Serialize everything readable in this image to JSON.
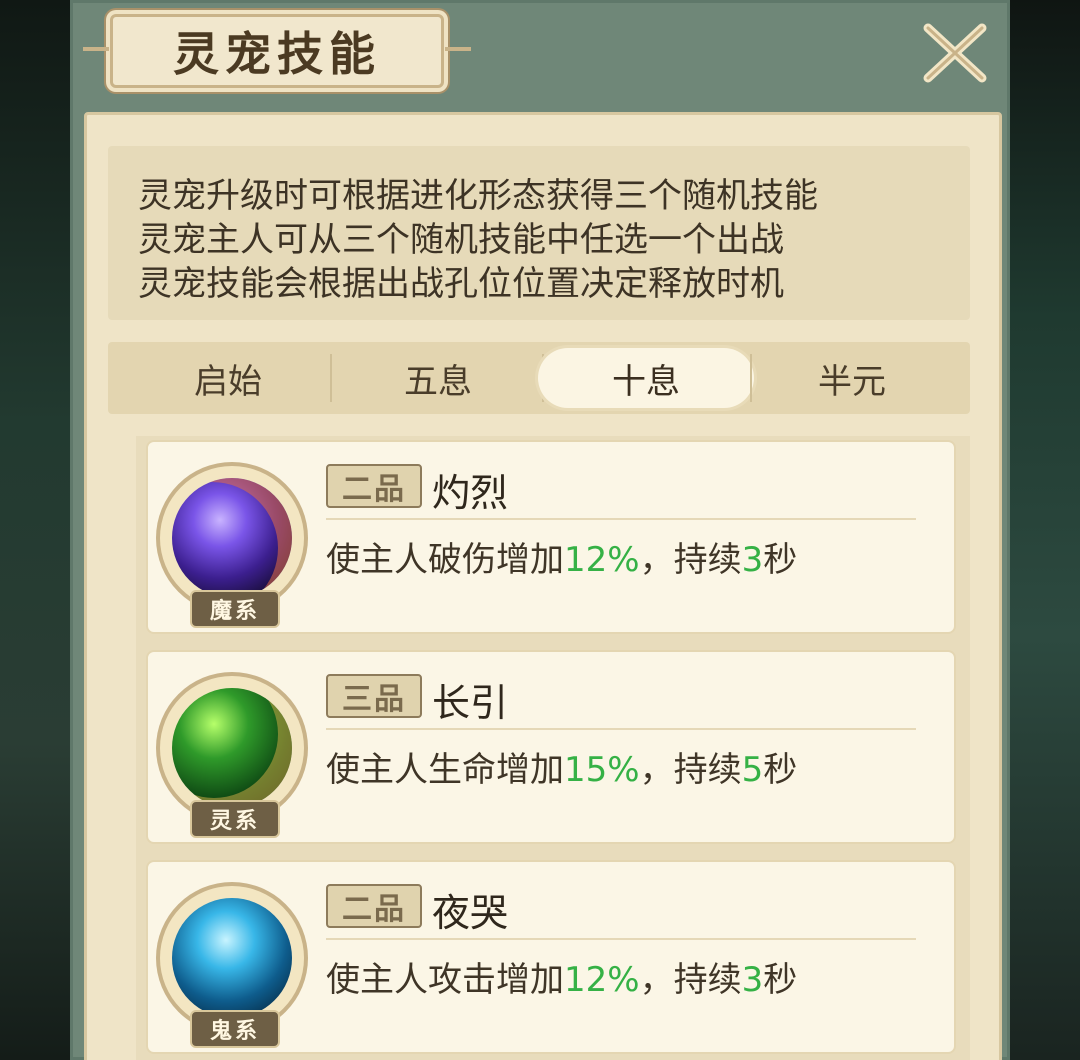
{
  "window": {
    "title": "灵宠技能",
    "close_icon": "close-icon"
  },
  "description": [
    "灵宠升级时可根据进化形态获得三个随机技能",
    "灵宠主人可从三个随机技能中任选一个出战",
    "灵宠技能会根据出战孔位位置决定释放时机"
  ],
  "tabs": [
    {
      "label": "启始",
      "active": false
    },
    {
      "label": "五息",
      "active": false
    },
    {
      "label": "十息",
      "active": true
    },
    {
      "label": "半元",
      "active": false
    }
  ],
  "skills": [
    {
      "grade": "二品",
      "name": "灼烈",
      "school": "魔系",
      "effect_prefix": "使主人破伤增加",
      "effect_value": "12%",
      "effect_mid": "，持续",
      "effect_duration": "3",
      "effect_unit": "秒",
      "icon": "purple-flame-skill-icon"
    },
    {
      "grade": "三品",
      "name": "长引",
      "school": "灵系",
      "effect_prefix": "使主人生命增加",
      "effect_value": "15%",
      "effect_mid": "，持续",
      "effect_duration": "5",
      "effect_unit": "秒",
      "icon": "green-blade-skill-icon"
    },
    {
      "grade": "二品",
      "name": "夜哭",
      "school": "鬼系",
      "effect_prefix": "使主人攻击增加",
      "effect_value": "12%",
      "effect_mid": "，持续",
      "effect_duration": "3",
      "effect_unit": "秒",
      "icon": "blue-spirit-skill-icon"
    }
  ],
  "colors": {
    "panel_frame": "#6f8778",
    "parchment": "#efe4c7",
    "highlight_green": "#35b145",
    "text_dark": "#3d3325"
  }
}
